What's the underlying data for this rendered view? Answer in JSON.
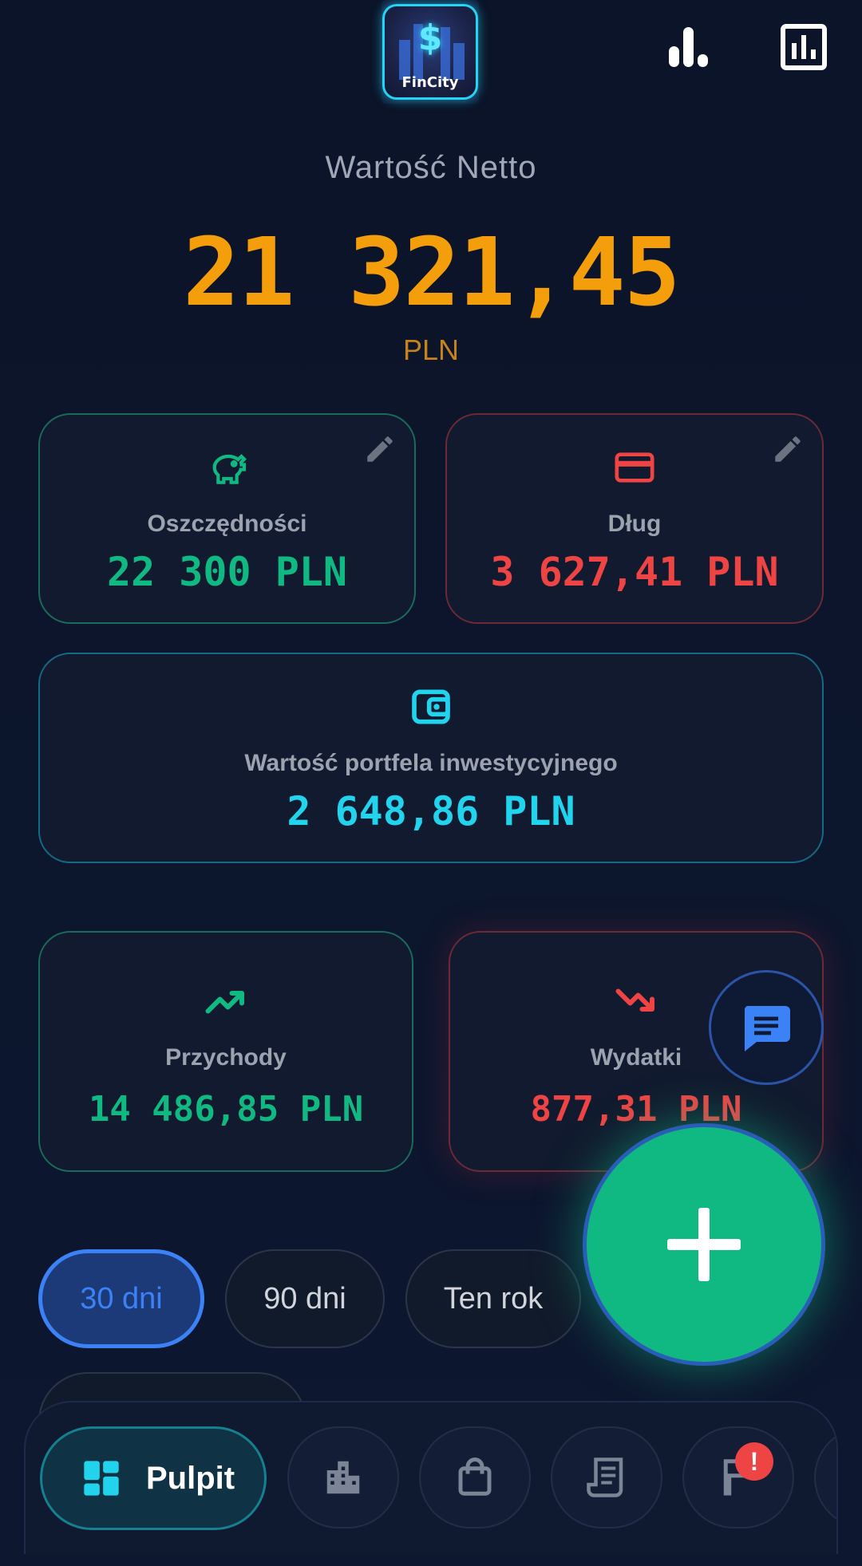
{
  "header": {
    "logo_text": "FinCity",
    "icons": [
      "bar-chart-icon",
      "report-icon"
    ]
  },
  "net_worth": {
    "label": "Wartość Netto",
    "value": "21 321,45",
    "currency": "PLN"
  },
  "cards": {
    "savings": {
      "label": "Oszczędności",
      "value": "22 300 PLN",
      "icon": "piggy-bank-icon"
    },
    "debt": {
      "label": "Dług",
      "value": "3 627,41 PLN",
      "icon": "credit-card-icon"
    },
    "portfolio": {
      "label": "Wartość portfela inwestycyjnego",
      "value": "2 648,86 PLN",
      "icon": "wallet-icon"
    },
    "income": {
      "label": "Przychody",
      "value": "14 486,85 PLN",
      "icon": "trending-up-icon"
    },
    "expenses": {
      "label": "Wydatki",
      "value": "877,31 PLN",
      "icon": "trending-down-icon"
    }
  },
  "periods": {
    "items": [
      "30 dni",
      "90 dni",
      "Ten rok"
    ],
    "selected": "30 dni"
  },
  "nav": {
    "active_label": "Pulpit",
    "items": [
      "dashboard-icon",
      "building-icon",
      "shopping-bag-icon",
      "receipt-icon",
      "flag-icon"
    ],
    "badge": "!"
  },
  "colors": {
    "accent_orange": "#f59e0b",
    "green": "#10b981",
    "red": "#ef4444",
    "cyan": "#22d3ee",
    "blue": "#3b82f6",
    "background": "#0b1428"
  }
}
